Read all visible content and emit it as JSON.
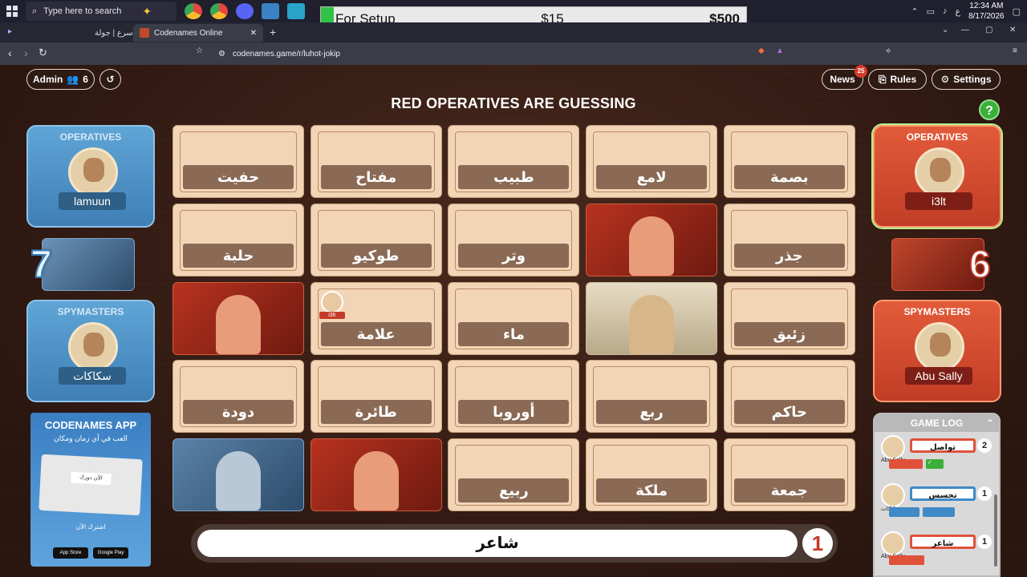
{
  "taskbar": {
    "search_placeholder": "Type here to search",
    "clock_time": "12:34 AM",
    "clock_date": "8/17/2026",
    "lang": "ع"
  },
  "ad": {
    "label": "For Setup",
    "price1": "$15",
    "price2": "$500"
  },
  "browser": {
    "tabs": [
      {
        "label": "اسرع | جولة"
      },
      {
        "label": "Codenames Online"
      }
    ],
    "url": "codenames.game/r/luhot-jokip"
  },
  "header": {
    "admin_label": "Admin",
    "player_count": "6",
    "news_label": "News",
    "news_badge": "25",
    "rules_label": "Rules",
    "settings_label": "Settings",
    "status_title": "RED OPERATIVES ARE GUESSING",
    "help": "?"
  },
  "blue_team": {
    "operatives_title": "OPERATIVES",
    "operative_name": "lamuun",
    "score": "7",
    "spymasters_title": "SPYMASTERS",
    "spymaster_name": "سكاكات"
  },
  "red_team": {
    "operatives_title": "OPERATIVES",
    "operative_name": "i3lt",
    "score": "6",
    "spymasters_title": "SPYMASTERS",
    "spymaster_name": "Abu Sally"
  },
  "board": {
    "cards": [
      {
        "word": "حفيت",
        "state": "hidden"
      },
      {
        "word": "مفتاح",
        "state": "hidden"
      },
      {
        "word": "طبيب",
        "state": "hidden"
      },
      {
        "word": "لامع",
        "state": "hidden"
      },
      {
        "word": "بصمة",
        "state": "hidden"
      },
      {
        "word": "حلبة",
        "state": "hidden"
      },
      {
        "word": "طوكيو",
        "state": "hidden"
      },
      {
        "word": "وتر",
        "state": "hidden"
      },
      {
        "word": "",
        "state": "red"
      },
      {
        "word": "جذر",
        "state": "hidden"
      },
      {
        "word": "",
        "state": "red"
      },
      {
        "word": "علامة",
        "state": "hidden",
        "tag": "i3lt"
      },
      {
        "word": "ماء",
        "state": "hidden"
      },
      {
        "word": "",
        "state": "bystander"
      },
      {
        "word": "زئبق",
        "state": "hidden"
      },
      {
        "word": "دودة",
        "state": "hidden"
      },
      {
        "word": "طائرة",
        "state": "hidden"
      },
      {
        "word": "أوروبا",
        "state": "hidden"
      },
      {
        "word": "ربع",
        "state": "hidden"
      },
      {
        "word": "حاكم",
        "state": "hidden"
      },
      {
        "word": "",
        "state": "blue"
      },
      {
        "word": "",
        "state": "red"
      },
      {
        "word": "ربيع",
        "state": "hidden"
      },
      {
        "word": "ملكة",
        "state": "hidden"
      },
      {
        "word": "جمعة",
        "state": "hidden"
      }
    ]
  },
  "clue": {
    "word": "شاعر",
    "number": "1"
  },
  "app_ad": {
    "title": "CODENAMES APP",
    "subtitle": "العب في أي زمان ومكان",
    "screen_text": "الآن دورك",
    "cta": "اشترك الآن",
    "store1": "App Store",
    "store2": "Google Play"
  },
  "game_log": {
    "title": "GAME LOG",
    "entries": [
      {
        "name": "Abu Sally",
        "clue": "تواصل",
        "num": "2",
        "team": "red"
      },
      {
        "name": "سكاكات",
        "clue": "تجسس",
        "num": "1",
        "team": "blue"
      },
      {
        "name": "Abu Sally",
        "clue": "شاعر",
        "num": "1",
        "team": "red"
      }
    ]
  }
}
